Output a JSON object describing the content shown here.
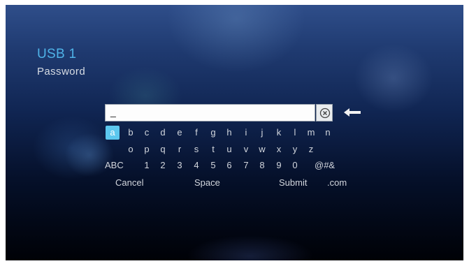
{
  "header": {
    "title": "USB 1",
    "subtitle": "Password"
  },
  "input": {
    "value": "_",
    "clear_icon": "clear-icon",
    "backspace_icon": "backspace-arrow-icon"
  },
  "keyboard": {
    "row1": [
      "a",
      "b",
      "c",
      "d",
      "e",
      "f",
      "g",
      "h",
      "i",
      "j",
      "k",
      "l",
      "m",
      "n"
    ],
    "row2": [
      "o",
      "p",
      "q",
      "r",
      "s",
      "t",
      "u",
      "v",
      "w",
      "x",
      "y",
      "z"
    ],
    "row3": [
      "ABC",
      "1",
      "2",
      "3",
      "4",
      "5",
      "6",
      "7",
      "8",
      "9",
      "0",
      "@#&"
    ],
    "selected_key": "a"
  },
  "actions": {
    "cancel": "Cancel",
    "space": "Space",
    "submit": "Submit",
    "dotcom": ".com"
  },
  "colors": {
    "accent": "#4fb3e8",
    "selected_key_bg": "#5cc7ee"
  }
}
